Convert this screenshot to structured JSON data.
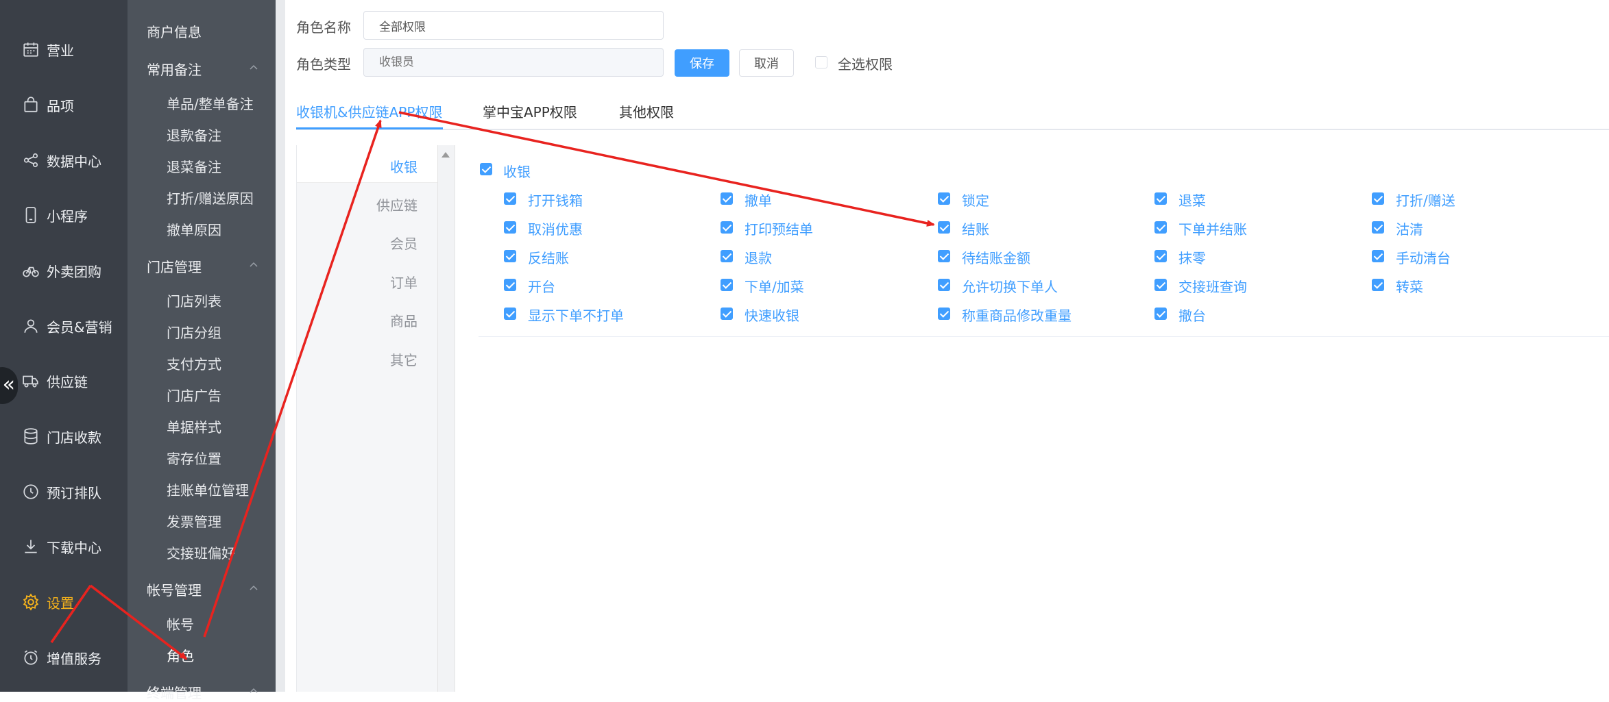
{
  "nav_primary": [
    {
      "label": "营业",
      "icon": "calendar-icon"
    },
    {
      "label": "品项",
      "icon": "shopping-bag-icon"
    },
    {
      "label": "数据中心",
      "icon": "share-icon"
    },
    {
      "label": "小程序",
      "icon": "mobile-icon"
    },
    {
      "label": "外卖团购",
      "icon": "bicycle-icon"
    },
    {
      "label": "会员&营销",
      "icon": "user-icon"
    },
    {
      "label": "供应链",
      "icon": "truck-icon"
    },
    {
      "label": "门店收款",
      "icon": "database-icon"
    },
    {
      "label": "预订排队",
      "icon": "clock-icon"
    },
    {
      "label": "下载中心",
      "icon": "download-icon"
    },
    {
      "label": "设置",
      "icon": "gear-icon",
      "active": true
    },
    {
      "label": "增值服务",
      "icon": "alarm-clock-icon"
    }
  ],
  "nav_secondary": {
    "merchant_info": "商户信息",
    "groups": [
      {
        "title": "常用备注",
        "items": [
          "单品/整单备注",
          "退款备注",
          "退菜备注",
          "打折/赠送原因",
          "撤单原因"
        ]
      },
      {
        "title": "门店管理",
        "items": [
          "门店列表",
          "门店分组",
          "支付方式",
          "门店广告",
          "单据样式",
          "寄存位置",
          "挂账单位管理",
          "发票管理",
          "交接班偏好"
        ]
      },
      {
        "title": "帐号管理",
        "items": [
          "帐号",
          "角色"
        ]
      },
      {
        "title": "终端管理",
        "items": []
      }
    ],
    "active_item": "角色"
  },
  "form": {
    "role_name_label": "角色名称",
    "role_name_value": "全部权限",
    "role_type_label": "角色类型",
    "role_type_placeholder": "收银员",
    "save_label": "保存",
    "cancel_label": "取消",
    "select_all_label": "全选权限"
  },
  "tabs": [
    {
      "label": "收银机&供应链APP权限",
      "active": true
    },
    {
      "label": "掌中宝APP权限",
      "active": false
    },
    {
      "label": "其他权限",
      "active": false
    }
  ],
  "categories": [
    {
      "label": "收银",
      "active": true
    },
    {
      "label": "供应链",
      "active": false
    },
    {
      "label": "会员",
      "active": false
    },
    {
      "label": "订单",
      "active": false
    },
    {
      "label": "商品",
      "active": false
    },
    {
      "label": "其它",
      "active": false
    }
  ],
  "permissions": {
    "group_label": "收银",
    "rows": [
      [
        "打开钱箱",
        "撤单",
        "锁定",
        "退菜",
        "打折/赠送"
      ],
      [
        "取消优惠",
        "打印预结单",
        "结账",
        "下单并结账",
        "沽清"
      ],
      [
        "反结账",
        "退款",
        "待结账金额",
        "抹零",
        "手动清台"
      ],
      [
        "开台",
        "下单/加菜",
        "允许切换下单人",
        "交接班查询",
        "转菜"
      ],
      [
        "显示下单不打单",
        "快速收银",
        "称重商品修改重量",
        "撤台"
      ]
    ]
  },
  "colors": {
    "accent": "#409eff",
    "nav_primary_bg": "#3a3f47",
    "nav_secondary_bg": "#4d535b",
    "active_nav": "#f5b21b",
    "annotation_arrow": "#e8231f"
  }
}
